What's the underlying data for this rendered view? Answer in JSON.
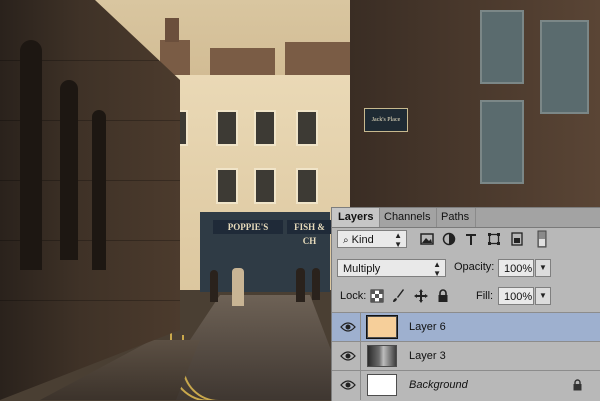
{
  "photo": {
    "shop_sign": "POPPIE'S",
    "shop_sign_2": "FISH & CH",
    "hanging_sign": "Jack's Place"
  },
  "layers_panel": {
    "tabs": [
      {
        "label": "Layers",
        "active": true
      },
      {
        "label": "Channels",
        "active": false
      },
      {
        "label": "Paths",
        "active": false
      }
    ],
    "filter": {
      "kind_label": "Kind",
      "search_icon": "search-icon"
    },
    "filter_icons": [
      "image-filter-icon",
      "adjustment-filter-icon",
      "type-filter-icon",
      "shape-filter-icon",
      "smart-object-filter-icon",
      "filter-toggle-icon"
    ],
    "blend_mode": "Multiply",
    "opacity_label": "Opacity:",
    "opacity_value": "100%",
    "lock_label": "Lock:",
    "lock_icons": [
      "lock-transparent-icon",
      "lock-paint-icon",
      "lock-move-icon",
      "lock-all-icon"
    ],
    "fill_label": "Fill:",
    "fill_value": "100%",
    "layers": [
      {
        "name": "Layer 6",
        "selected": true,
        "thumb_color": "#f6cf9a",
        "visible": true
      },
      {
        "name": "Layer 3",
        "selected": false,
        "thumb": "photo",
        "visible": true
      },
      {
        "name": "Background",
        "selected": false,
        "thumb_color": "#ffffff",
        "visible": true,
        "locked": true
      }
    ],
    "colors": {
      "panel_bg": "#b8b8b8",
      "selected_row": "#9eb0cf",
      "layer6_fill": "#f6cf9a"
    }
  }
}
